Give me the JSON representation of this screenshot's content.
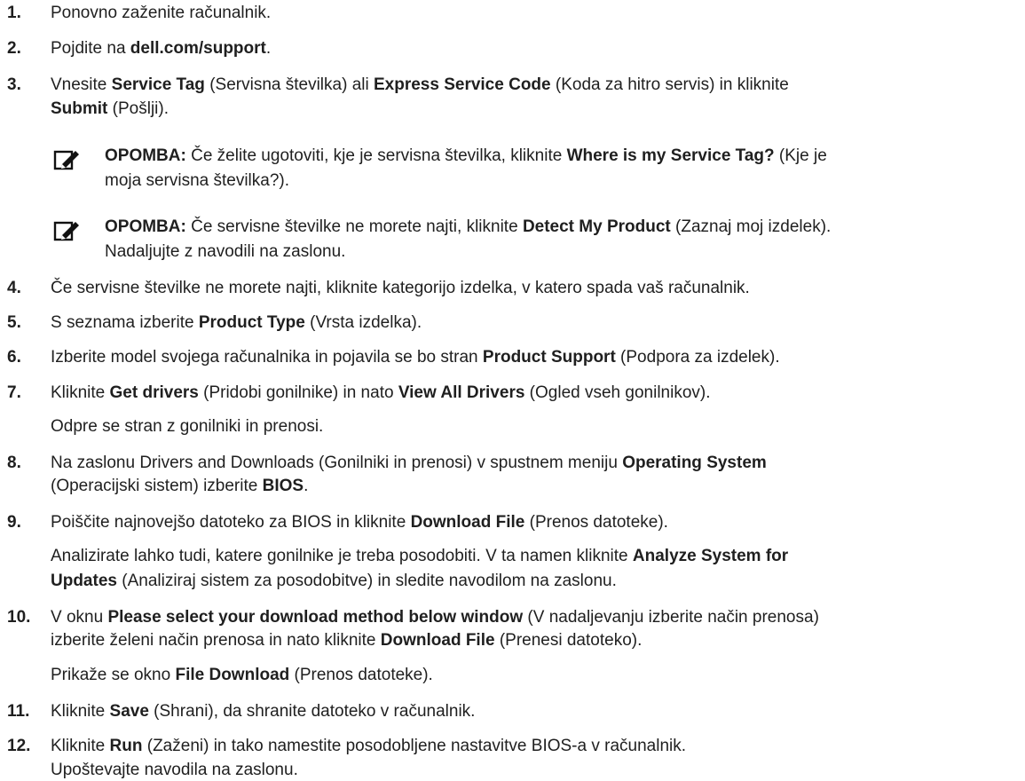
{
  "steps": [
    {
      "num": "1.",
      "p": [
        {
          "t": "Ponovno zaženite računalnik."
        }
      ]
    },
    {
      "num": "2.",
      "p": [
        {
          "t": "Pojdite na "
        },
        {
          "b": "dell.com/support"
        },
        {
          "t": "."
        }
      ]
    },
    {
      "num": "3.",
      "p": [
        {
          "t": "Vnesite "
        },
        {
          "b": "Service Tag"
        },
        {
          "t": " (Servisna številka) ali "
        },
        {
          "b": "Express Service Code"
        },
        {
          "t": " (Koda za hitro servis) in kliknite"
        }
      ],
      "p2": [
        {
          "b": "Submit"
        },
        {
          "t": " (Pošlji)."
        }
      ]
    },
    {
      "num": "4.",
      "p": [
        {
          "t": "Če servisne številke ne morete najti, kliknite kategorijo izdelka, v katero spada vaš računalnik."
        }
      ]
    },
    {
      "num": "5.",
      "p": [
        {
          "t": "S seznama izberite "
        },
        {
          "b": "Product Type"
        },
        {
          "t": " (Vrsta izdelka)."
        }
      ]
    },
    {
      "num": "6.",
      "p": [
        {
          "t": "Izberite model svojega računalnika in pojavila se bo stran "
        },
        {
          "b": "Product Support"
        },
        {
          "t": " (Podpora za izdelek)."
        }
      ]
    },
    {
      "num": "7.",
      "p": [
        {
          "t": "Kliknite "
        },
        {
          "b": "Get drivers"
        },
        {
          "t": " (Pridobi gonilnike) in nato "
        },
        {
          "b": "View All Drivers"
        },
        {
          "t": " (Ogled vseh gonilnikov)."
        }
      ],
      "p2": [
        {
          "t": "Odpre se stran z gonilniki in prenosi."
        }
      ]
    },
    {
      "num": "8.",
      "p": [
        {
          "t": "Na zaslonu Drivers and Downloads (Gonilniki in prenosi) v spustnem meniju "
        },
        {
          "b": "Operating System"
        }
      ],
      "p2": [
        {
          "t": "(Operacijski sistem) izberite "
        },
        {
          "b": "BIOS"
        },
        {
          "t": "."
        }
      ]
    },
    {
      "num": "9.",
      "p": [
        {
          "t": "Poiščite najnovejšo datoteko za BIOS in kliknite "
        },
        {
          "b": "Download File"
        },
        {
          "t": " (Prenos datoteke)."
        }
      ],
      "p2": [
        {
          "t": "Analizirate lahko tudi, katere gonilnike je treba posodobiti. V ta namen kliknite "
        },
        {
          "b": "Analyze System for"
        }
      ],
      "p3": [
        {
          "b": "Updates"
        },
        {
          "t": " (Analiziraj sistem za posodobitve) in sledite navodilom na zaslonu."
        }
      ]
    },
    {
      "num": "10.",
      "p": [
        {
          "t": "V oknu "
        },
        {
          "b": "Please select your download method below window"
        },
        {
          "t": " (V nadaljevanju izberite način prenosa)"
        }
      ],
      "p2": [
        {
          "t": "izberite želeni način prenosa in nato kliknite "
        },
        {
          "b": "Download File"
        },
        {
          "t": " (Prenesi datoteko)."
        }
      ],
      "p3": [
        {
          "t": "Prikaže se okno "
        },
        {
          "b": "File Download"
        },
        {
          "t": " (Prenos datoteke)."
        }
      ]
    },
    {
      "num": "11.",
      "p": [
        {
          "t": "Kliknite "
        },
        {
          "b": "Save"
        },
        {
          "t": " (Shrani), da shranite datoteko v računalnik."
        }
      ]
    },
    {
      "num": "12.",
      "p": [
        {
          "t": "Kliknite "
        },
        {
          "b": "Run"
        },
        {
          "t": " (Zaženi) in tako namestite posodobljene nastavitve BIOS-a v računalnik."
        }
      ],
      "p2": [
        {
          "t": "Upoštevajte navodila na zaslonu."
        }
      ]
    }
  ],
  "notes": [
    {
      "icon": "note-pencil-icon",
      "l1": [
        {
          "b": "OPOMBA:"
        },
        {
          "t": " Če želite ugotoviti, kje je servisna številka, kliknite "
        },
        {
          "b": "Where is my Service Tag?"
        },
        {
          "t": " (Kje je"
        }
      ],
      "l2": [
        {
          "t": "moja servisna številka?)."
        }
      ]
    },
    {
      "icon": "note-pencil-icon",
      "l1": [
        {
          "b": "OPOMBA:"
        },
        {
          "t": " Če servisne številke ne morete najti, kliknite "
        },
        {
          "b": "Detect My Product"
        },
        {
          "t": " (Zaznaj moj izdelek)."
        }
      ],
      "l2": [
        {
          "t": "Nadaljujte z navodili na zaslonu."
        }
      ]
    }
  ],
  "colors": {
    "text": "#1f1f1f",
    "icon": "#111111"
  }
}
